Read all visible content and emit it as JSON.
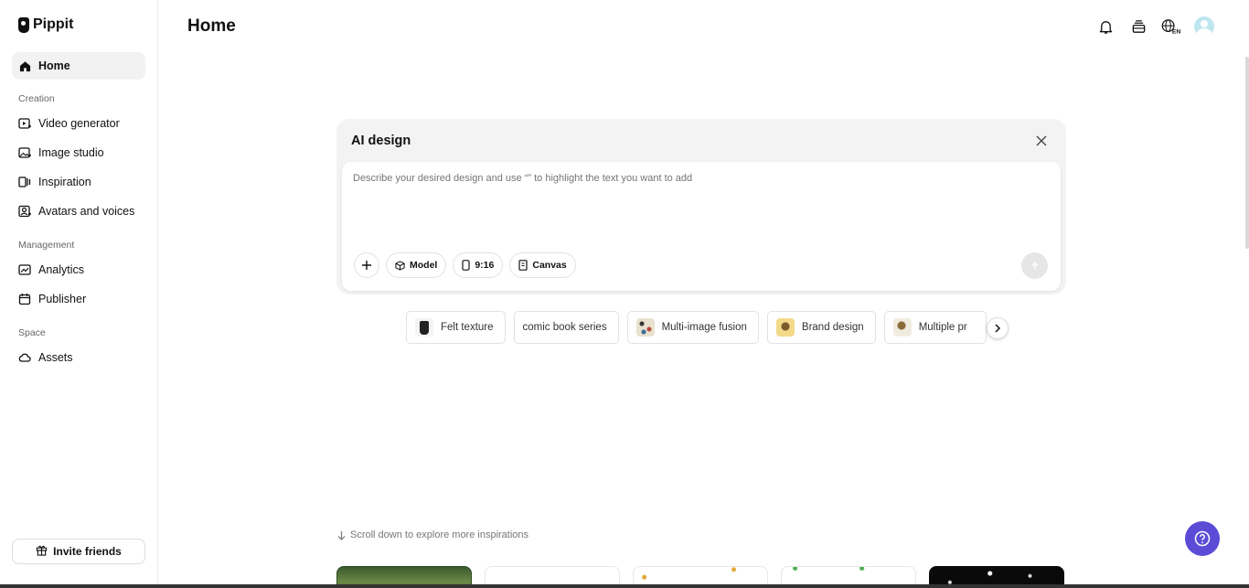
{
  "brand": {
    "name": "Pippit"
  },
  "sidebar": {
    "home": "Home",
    "sections": {
      "creation": "Creation",
      "management": "Management",
      "space": "Space"
    },
    "creation_items": [
      {
        "label": "Video generator",
        "icon": "video-plus-icon"
      },
      {
        "label": "Image studio",
        "icon": "image-plus-icon"
      },
      {
        "label": "Inspiration",
        "icon": "inspiration-icon"
      },
      {
        "label": "Avatars and voices",
        "icon": "avatar-icon"
      }
    ],
    "management_items": [
      {
        "label": "Analytics",
        "icon": "chart-icon"
      },
      {
        "label": "Publisher",
        "icon": "calendar-icon"
      }
    ],
    "space_items": [
      {
        "label": "Assets",
        "icon": "cloud-icon"
      }
    ],
    "invite": "Invite friends"
  },
  "header": {
    "title": "Home",
    "icons": [
      "bell-icon",
      "stack-icon",
      "globe-language-icon",
      "avatar"
    ]
  },
  "ai_design": {
    "title": "AI design",
    "placeholder": "Describe your desired design and use “” to highlight the text you want to add",
    "tools": {
      "model": "Model",
      "ratio": "9:16",
      "canvas": "Canvas"
    }
  },
  "chips": [
    {
      "label": "Felt texture",
      "thumb_color": "#222222"
    },
    {
      "label": "comic book series"
    },
    {
      "label": "Multi-image fusion",
      "thumb_color": "#e9e2cf"
    },
    {
      "label": "Brand design",
      "thumb_color": "#f3d98a"
    },
    {
      "label": "Multiple pr",
      "thumb_color": "#d9c79a"
    }
  ],
  "scroll_hint": "Scroll down to explore more inspirations",
  "colors": {
    "accent": "#5b4bd6",
    "active_nav_bg": "#f2f2f2",
    "card_bg": "#f3f3f3"
  }
}
